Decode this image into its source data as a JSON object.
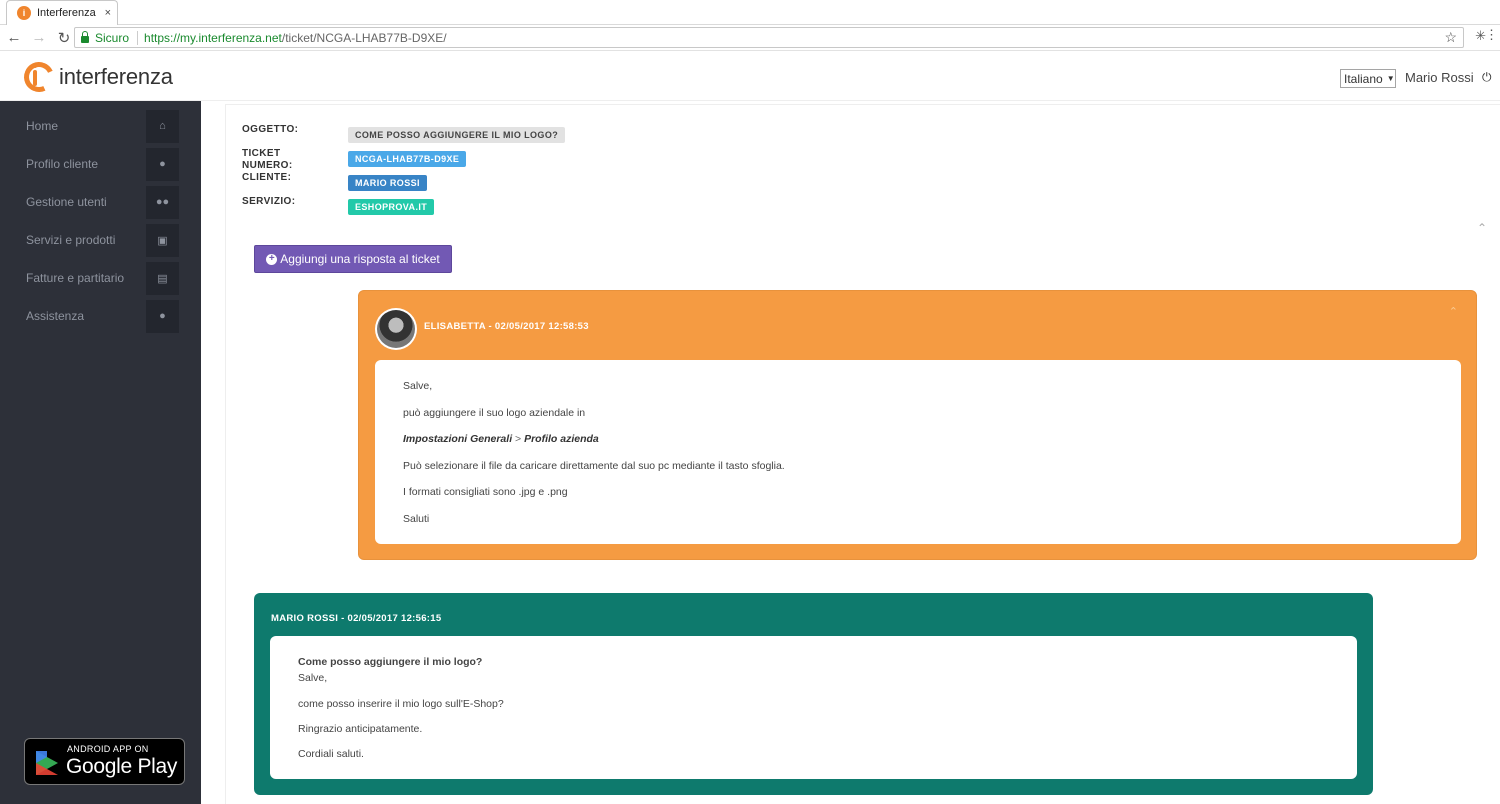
{
  "browser": {
    "tab_title": "Interferenza",
    "tab_close": "×",
    "secure_label": "Sicuro",
    "url_host": "https://my.interferenza.net",
    "url_path": "/ticket/NCGA-LHAB77B-D9XE/"
  },
  "header": {
    "logo_text": "interferenza",
    "language": "Italiano",
    "user_name": "Mario Rossi"
  },
  "sidebar": {
    "items": [
      {
        "label": "Home",
        "icon": "home-icon"
      },
      {
        "label": "Profilo cliente",
        "icon": "user-icon"
      },
      {
        "label": "Gestione utenti",
        "icon": "users-icon"
      },
      {
        "label": "Servizi e prodotti",
        "icon": "cubes-icon"
      },
      {
        "label": "Fatture e partitario",
        "icon": "file-icon"
      },
      {
        "label": "Assistenza",
        "icon": "comments-icon"
      }
    ],
    "store_badge": {
      "small": "ANDROID APP ON",
      "big": "Google Play"
    }
  },
  "ticket": {
    "oggetto_label": "OGGETTO:",
    "oggetto_value": "COME POSSO AGGIUNGERE IL MIO LOGO?",
    "numero_label_1": "TICKET",
    "numero_label_2": "NUMERO:",
    "numero_value": "NCGA-LHAB77B-D9XE",
    "cliente_label": "CLIENTE:",
    "cliente_value": "MARIO ROSSI",
    "servizio_label": "SERVIZIO:",
    "servizio_value": "ESHOPROVA.IT",
    "badge_colors": {
      "oggetto": "#e2e2e2",
      "numero": "#4aa8e8",
      "cliente": "#3884c6",
      "servizio": "#22c9a9"
    }
  },
  "reply_button": "Aggiungi una risposta al ticket",
  "messages": [
    {
      "header": "ELISABETTA - 02/05/2017 12:58:53",
      "color": "#f59b42",
      "lines": [
        "Salve,",
        "può aggiungere il suo logo aziendale in",
        "Impostazioni Generali",
        ">",
        "Profilo azienda",
        "Può selezionare il file da caricare direttamente dal suo pc mediante il tasto sfoglia.",
        "I formati consigliati sono .jpg e .png",
        "Saluti"
      ]
    },
    {
      "header": "MARIO ROSSI - 02/05/2017 12:56:15",
      "color": "#0e7a6d",
      "lines": [
        "Come posso aggiungere il mio logo?",
        "Salve,",
        "come posso inserire il mio logo sull'E-Shop?",
        "Ringrazio anticipatamente.",
        "Cordiali saluti."
      ]
    }
  ]
}
